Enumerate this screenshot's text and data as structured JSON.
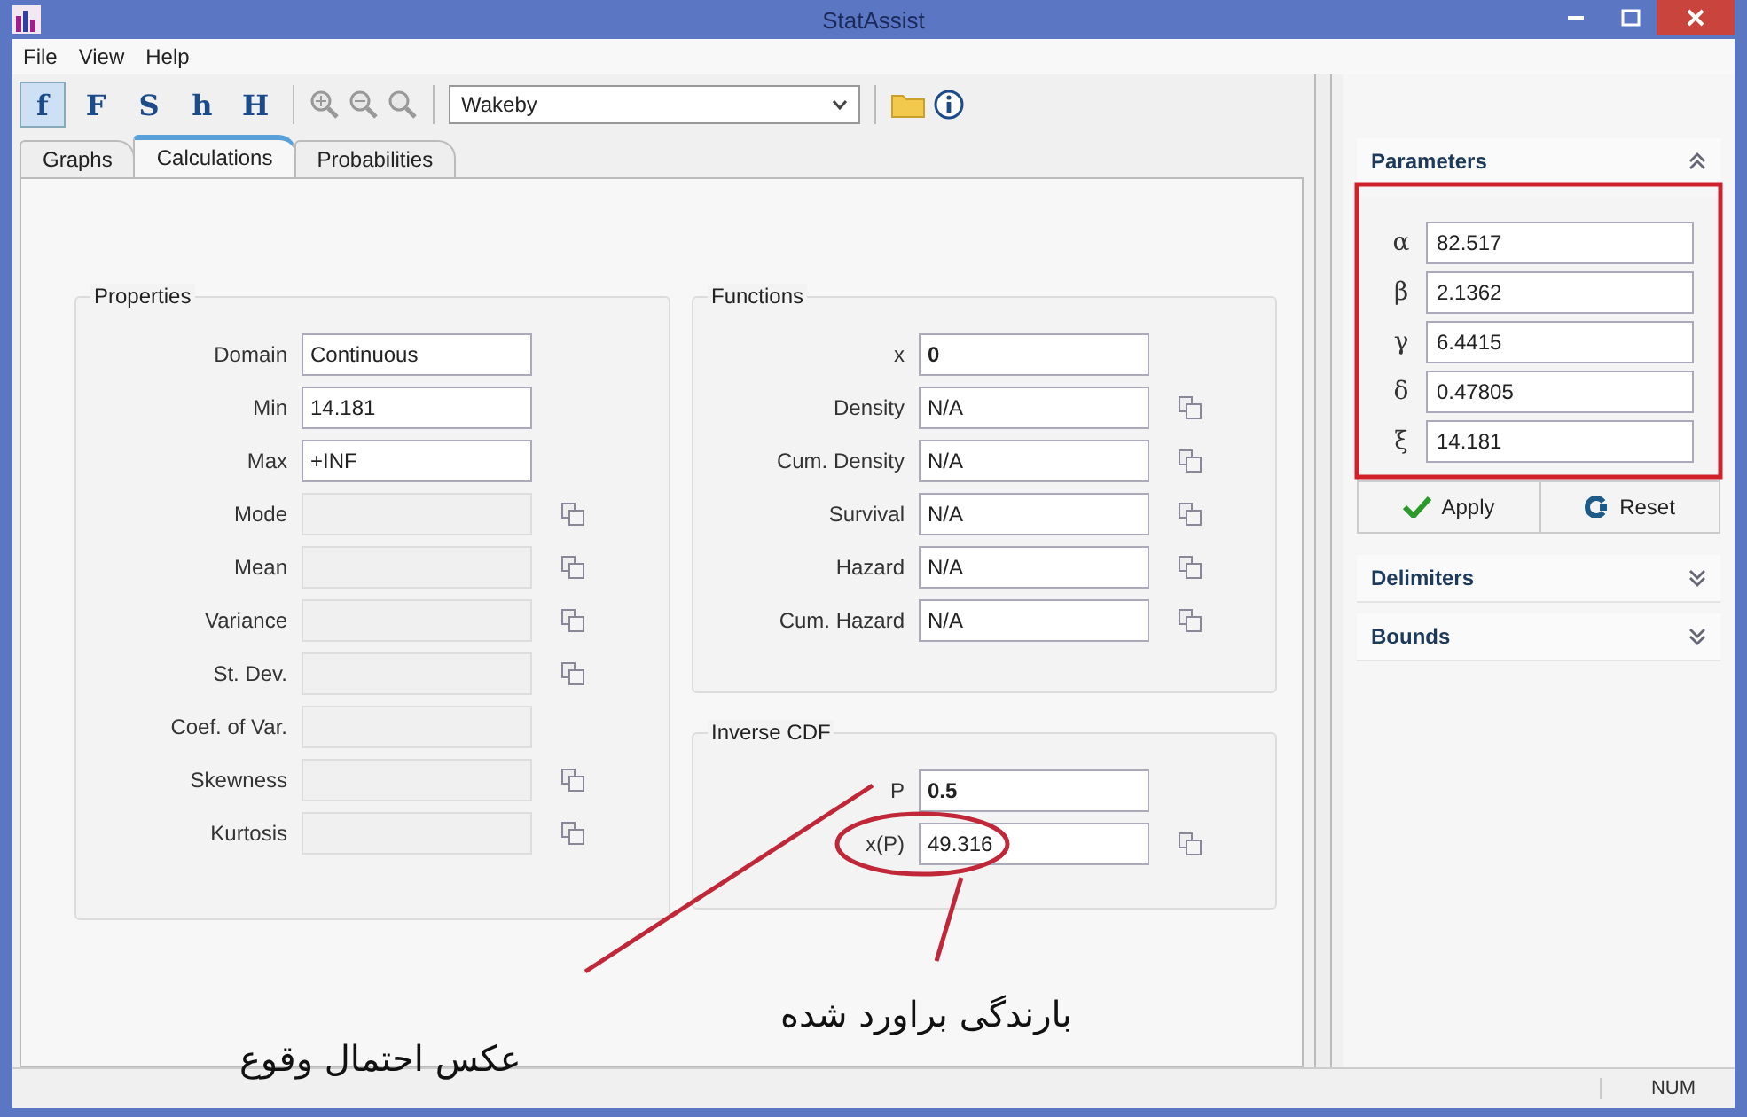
{
  "window": {
    "title": "StatAssist"
  },
  "menu": [
    "File",
    "View",
    "Help"
  ],
  "toolbar": {
    "tools": [
      {
        "label": "f",
        "selected": true
      },
      {
        "label": "F",
        "selected": false
      },
      {
        "label": "S",
        "selected": false
      },
      {
        "label": "h",
        "selected": false
      },
      {
        "label": "H",
        "selected": false
      }
    ],
    "distribution": "Wakeby"
  },
  "tabs": [
    {
      "label": "Graphs",
      "selected": false
    },
    {
      "label": "Calculations",
      "selected": true
    },
    {
      "label": "Probabilities",
      "selected": false
    }
  ],
  "properties": {
    "title": "Properties",
    "rows": [
      {
        "label": "Domain",
        "value": "Continuous",
        "disabled": false,
        "copy": false
      },
      {
        "label": "Min",
        "value": "14.181",
        "disabled": false,
        "copy": false
      },
      {
        "label": "Max",
        "value": "+INF",
        "disabled": false,
        "copy": false
      },
      {
        "label": "Mode",
        "disabled": true,
        "copy": true
      },
      {
        "label": "Mean",
        "disabled": true,
        "copy": true
      },
      {
        "label": "Variance",
        "disabled": true,
        "copy": true
      },
      {
        "label": "St. Dev.",
        "disabled": true,
        "copy": true
      },
      {
        "label": "Coef. of Var.",
        "disabled": true,
        "copy": false
      },
      {
        "label": "Skewness",
        "disabled": true,
        "copy": true
      },
      {
        "label": "Kurtosis",
        "disabled": true,
        "copy": true
      }
    ]
  },
  "functions": {
    "title": "Functions",
    "rows": [
      {
        "label": "x",
        "value": "0",
        "bold": true,
        "copy": false
      },
      {
        "label": "Density",
        "value": "N/A",
        "bold": false,
        "copy": true
      },
      {
        "label": "Cum. Density",
        "value": "N/A",
        "bold": false,
        "copy": true
      },
      {
        "label": "Survival",
        "value": "N/A",
        "bold": false,
        "copy": true
      },
      {
        "label": "Hazard",
        "value": "N/A",
        "bold": false,
        "copy": true
      },
      {
        "label": "Cum. Hazard",
        "value": "N/A",
        "bold": false,
        "copy": true
      }
    ]
  },
  "inverse_cdf": {
    "title": "Inverse CDF",
    "rows": [
      {
        "label": "P",
        "value": "0.5",
        "bold": true,
        "copy": false
      },
      {
        "label": "x(P)",
        "value": "49.316",
        "bold": false,
        "copy": true
      }
    ]
  },
  "parameters": {
    "title": "Parameters",
    "expanded": true,
    "rows": [
      {
        "symbol": "α",
        "value": "82.517"
      },
      {
        "symbol": "β",
        "value": "2.1362"
      },
      {
        "symbol": "γ",
        "value": "6.4415"
      },
      {
        "symbol": "δ",
        "value": "0.47805"
      },
      {
        "symbol": "ξ",
        "value": "14.181"
      }
    ],
    "buttons": [
      "Apply",
      "Reset"
    ]
  },
  "sections": [
    {
      "title": "Delimiters",
      "expanded": false
    },
    {
      "title": "Bounds",
      "expanded": false
    }
  ],
  "annotations": [
    {
      "text": "عکس احتمال وقوع"
    },
    {
      "text": "بارندگی براورد شده"
    }
  ],
  "status_bar": {
    "indicator": "NUM"
  }
}
